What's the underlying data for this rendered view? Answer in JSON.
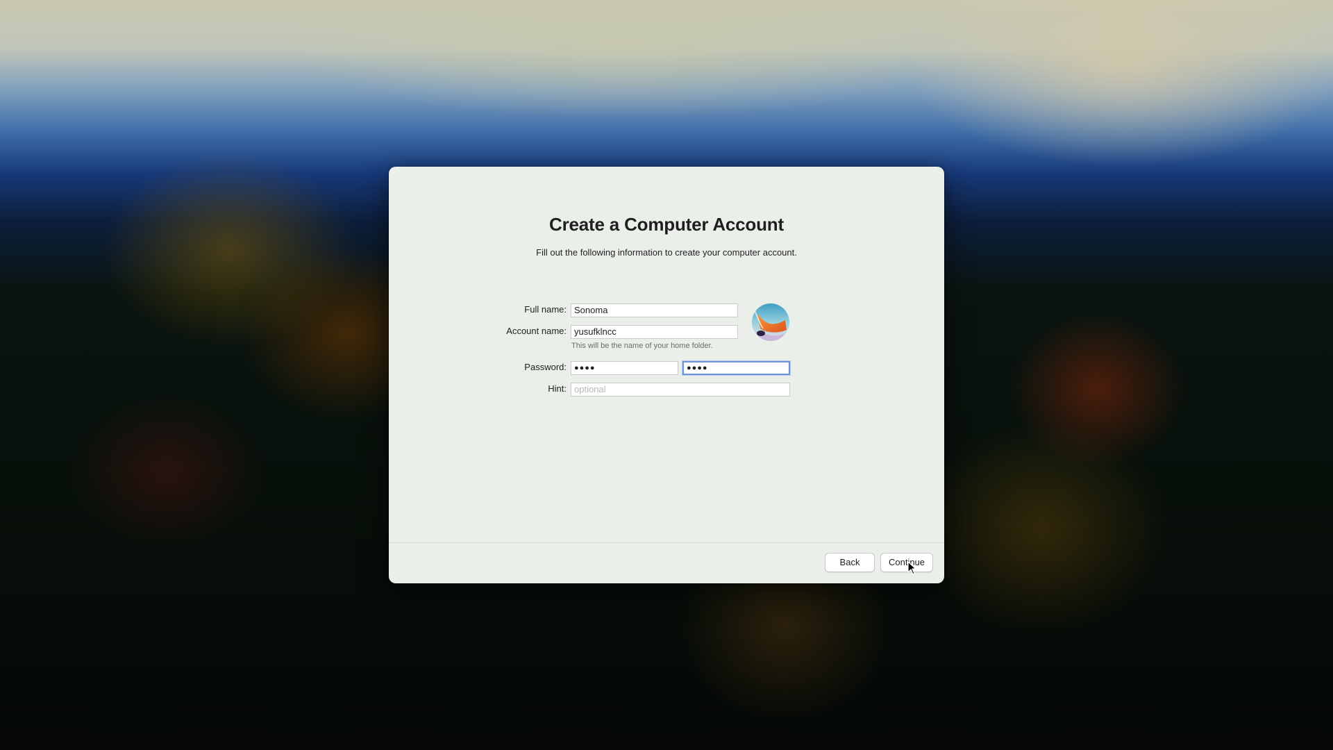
{
  "dialog": {
    "title": "Create a Computer Account",
    "subtitle": "Fill out the following information to create your computer account."
  },
  "form": {
    "full_name_label": "Full name:",
    "full_name_value": "Sonoma",
    "account_name_label": "Account name:",
    "account_name_value": "yusufklncc",
    "account_name_helper": "This will be the name of your home folder.",
    "password_label": "Password:",
    "password_value": "●●●●",
    "verify_value": "●●●●",
    "hint_label": "Hint:",
    "hint_placeholder": "optional"
  },
  "avatar": {
    "icon": "user-picture-icon"
  },
  "footer": {
    "back_label": "Back",
    "continue_label": "Continue"
  },
  "colors": {
    "dialog_bg": "#ebefea",
    "focus_ring": "#6f94d6"
  }
}
